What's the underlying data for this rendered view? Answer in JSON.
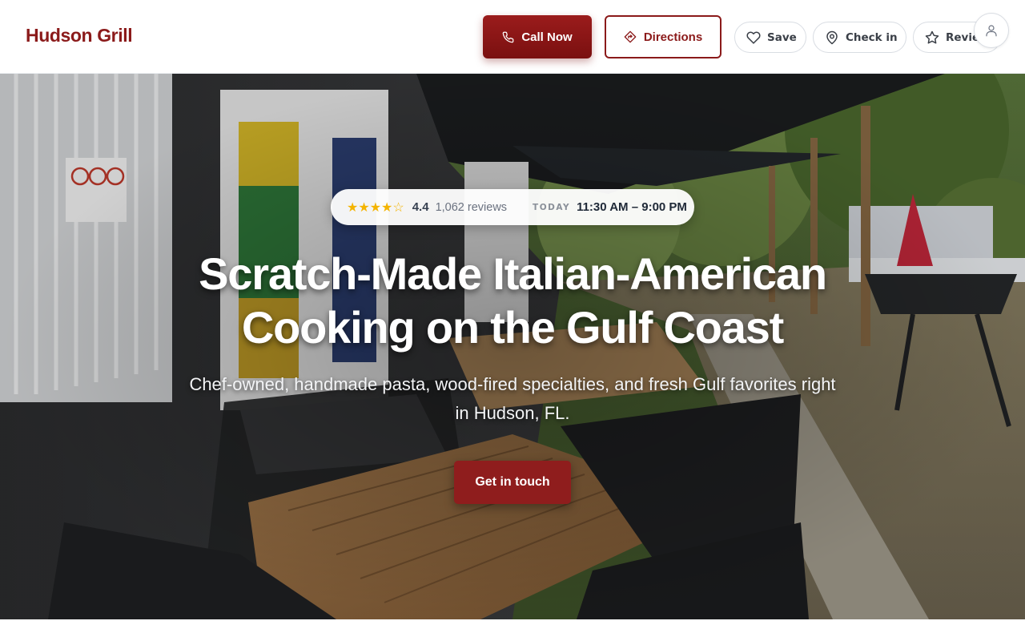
{
  "header": {
    "brand": "Hudson Grill",
    "call_label": "Call Now",
    "directions_label": "Directions",
    "save_label": "Save",
    "checkin_label": "Check in",
    "reviews_label": "Reviews"
  },
  "icons": {
    "call": "phone-icon",
    "directions": "directions-icon",
    "save": "heart-icon",
    "checkin": "map-pin-icon",
    "reviews": "star-icon",
    "account": "user-icon"
  },
  "hero": {
    "rating_value": "4.4",
    "rating_stars": 4.4,
    "review_count": "1,062 reviews",
    "today_label": "TODAY",
    "hours": "11:30 AM – 9:00 PM",
    "title_line1": "Scratch-Made Italian-American",
    "title_line2": "Cooking on the Gulf Coast",
    "subtitle": "Chef-owned, handmade pasta, wood-fired specialties, and fresh Gulf favorites right in Hudson, FL.",
    "cta_label": "Get in touch",
    "photo": "outdoor patio with wicker chairs and wooden tables, shade sails, trees, and a red umbrella"
  },
  "colors": {
    "brand": "#8b1a1a",
    "primary_button": "#8f1d1d",
    "star": "#f4b400"
  }
}
